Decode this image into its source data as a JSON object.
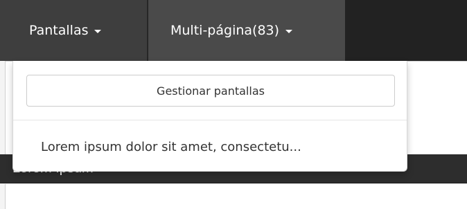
{
  "navbar": {
    "pantallas_label": "Pantallas",
    "multipagina_label": "Multi-página(83)"
  },
  "dropdown": {
    "manage_button_label": "Gestionar pantallas",
    "items": [
      {
        "label": "Lorem ipsum dolor sit amet, consectetu..."
      }
    ]
  },
  "panel": {
    "title": "Lorem Ipsum"
  },
  "colors": {
    "navbar_bg": "#222222",
    "active_tab_bg": "#4a4a4a",
    "panel_header_bg": "#2d2d2d"
  },
  "icons": {
    "nav_caret": "caret-down-icon"
  }
}
